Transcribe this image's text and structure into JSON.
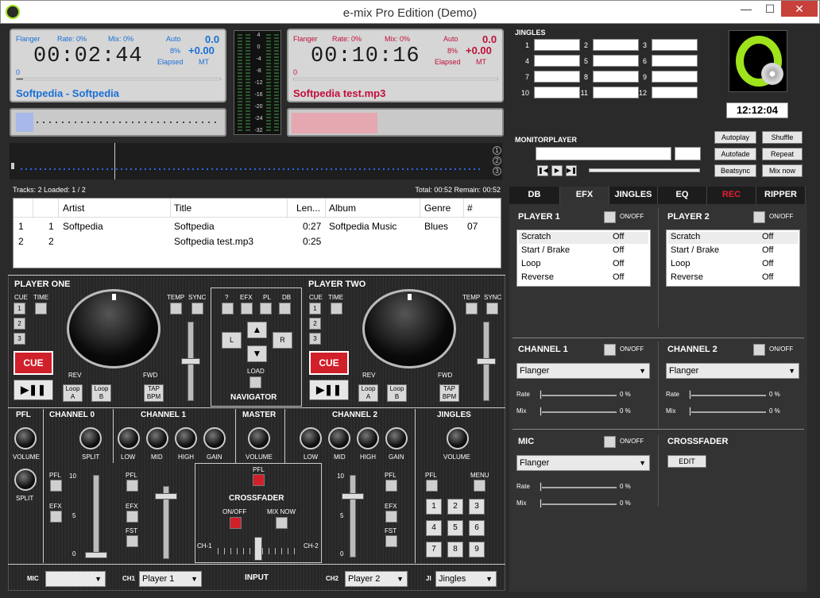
{
  "window": {
    "title": "e-mix Pro Edition (Demo)"
  },
  "deck1": {
    "flanger_label": "Flanger",
    "rate": "Rate: 0%",
    "mix": "Mix: 0%",
    "auto": "Auto",
    "auto_val": "0.0",
    "pct": "8%",
    "pitch": "+0.00",
    "elapsed": "Elapsed",
    "mt": "MT",
    "time": "00:02:44",
    "pos": "0",
    "track": "Softpedia - Softpedia",
    "progress": 0.03
  },
  "deck2": {
    "flanger_label": "Flanger",
    "rate": "Rate: 0%",
    "mix": "Mix: 0%",
    "auto": "Auto",
    "auto_val": "0.0",
    "pct": "8%",
    "pitch": "+0.00",
    "elapsed": "Elapsed",
    "mt": "MT",
    "time": "00:10:16",
    "pos": "0",
    "track": "Softpedia test.mp3",
    "progress": 0.0
  },
  "vu": {
    "labels": [
      "4",
      "0",
      "-4",
      "-8",
      "-12",
      "-16",
      "-20",
      "-24",
      "-32"
    ]
  },
  "deck_selectors": [
    "1",
    "2",
    "3"
  ],
  "jingles": {
    "title": "JINGLES",
    "slots": [
      "1",
      "2",
      "3",
      "4",
      "5",
      "6",
      "7",
      "8",
      "9",
      "10",
      "11",
      "12"
    ]
  },
  "clock": "12:12:04",
  "monitor": {
    "title": "MONITORPLAYER",
    "buttons": {
      "autoplay": "Autoplay",
      "shuffle": "Shuffle",
      "autofade": "Autofade",
      "repeat": "Repeat",
      "beatsync": "Beatsync",
      "mixnow": "Mix now"
    }
  },
  "playlist": {
    "status_left": "Tracks: 2 Loaded: 1 / 2",
    "status_right": "Total: 00:52 Remain: 00:52",
    "columns": [
      "Artist",
      "Title",
      "Len...",
      "Album",
      "Genre",
      "#"
    ],
    "rows": [
      {
        "idx": "1",
        "num": "1",
        "artist": "Softpedia",
        "title": "Softpedia",
        "len": "0:27",
        "album": "Softpedia Music",
        "genre": "Blues",
        "no": "07"
      },
      {
        "idx": "2",
        "num": "2",
        "artist": "",
        "title": "Softpedia test.mp3",
        "len": "0:25",
        "album": "",
        "genre": "",
        "no": ""
      }
    ]
  },
  "player_one": {
    "title": "PLAYER ONE",
    "cue_lbl": "CUE",
    "time_lbl": "TIME",
    "temp": "TEMP",
    "sync": "SYNC",
    "rev": "REV",
    "fwd": "FWD",
    "cue": "CUE",
    "play": "▶❚❚",
    "loopa": "Loop A",
    "loopb": "Loop B",
    "tap": "TAP BPM",
    "nums": [
      "1",
      "2",
      "3"
    ]
  },
  "player_two": {
    "title": "PLAYER TWO",
    "cue_lbl": "CUE",
    "time_lbl": "TIME",
    "temp": "TEMP",
    "sync": "SYNC",
    "rev": "REV",
    "fwd": "FWD",
    "cue": "CUE",
    "play": "▶❚❚",
    "loopa": "Loop A",
    "loopb": "Loop B",
    "tap": "TAP BPM",
    "nums": [
      "1",
      "2",
      "3"
    ]
  },
  "navigator": {
    "title": "NAVIGATOR",
    "q": "?",
    "efx": "EFX",
    "pl": "PL",
    "db": "DB",
    "l": "L",
    "r": "R",
    "load": "LOAD"
  },
  "mixer": {
    "pfl": "PFL",
    "volume": "VOLUME",
    "split": "SPLIT",
    "channel0": "CHANNEL 0",
    "channel1": "CHANNEL 1",
    "channel2": "CHANNEL 2",
    "master": "MASTER",
    "jingles": "JINGLES",
    "low": "LOW",
    "mid": "MID",
    "high": "HIGH",
    "gain": "GAIN",
    "efx": "EFX",
    "fst": "FST",
    "menu": "MENU",
    "crossfader": "CROSSFADER",
    "onoff": "ON/OFF",
    "mixnow": "MIX NOW",
    "ch1": "CH-1",
    "ch2": "CH-2",
    "scale": [
      "10",
      "5",
      "0"
    ],
    "keypad": [
      "1",
      "2",
      "3",
      "4",
      "5",
      "6",
      "7",
      "8",
      "9"
    ]
  },
  "input": {
    "mic": "MIC",
    "ch1": "CH1",
    "ch1_val": "Player 1",
    "title": "INPUT",
    "ch2": "CH2",
    "ch2_val": "Player 2",
    "ji": "JI",
    "ji_val": "Jingles"
  },
  "tabs": [
    "DB",
    "EFX",
    "JINGLES",
    "EQ",
    "REC",
    "RIPPER"
  ],
  "efx": {
    "player1": "PLAYER 1",
    "player2": "PLAYER 2",
    "onoff": "ON/OFF",
    "effects": [
      {
        "name": "Scratch",
        "val": "Off"
      },
      {
        "name": "Start / Brake",
        "val": "Off"
      },
      {
        "name": "Loop",
        "val": "Off"
      },
      {
        "name": "Reverse",
        "val": "Off"
      }
    ],
    "channel1": "CHANNEL 1",
    "channel2": "CHANNEL 2",
    "flanger": "Flanger",
    "rate": "Rate",
    "mix": "Mix",
    "zero": "0 %",
    "mic": "MIC",
    "crossfader": "CROSSFADER",
    "edit": "EDIT"
  },
  "colors": {
    "accent_blue": "#1a6fd6",
    "accent_red": "#c0103a",
    "cue_red": "#d0202a",
    "logo_green": "#9fe31c"
  }
}
